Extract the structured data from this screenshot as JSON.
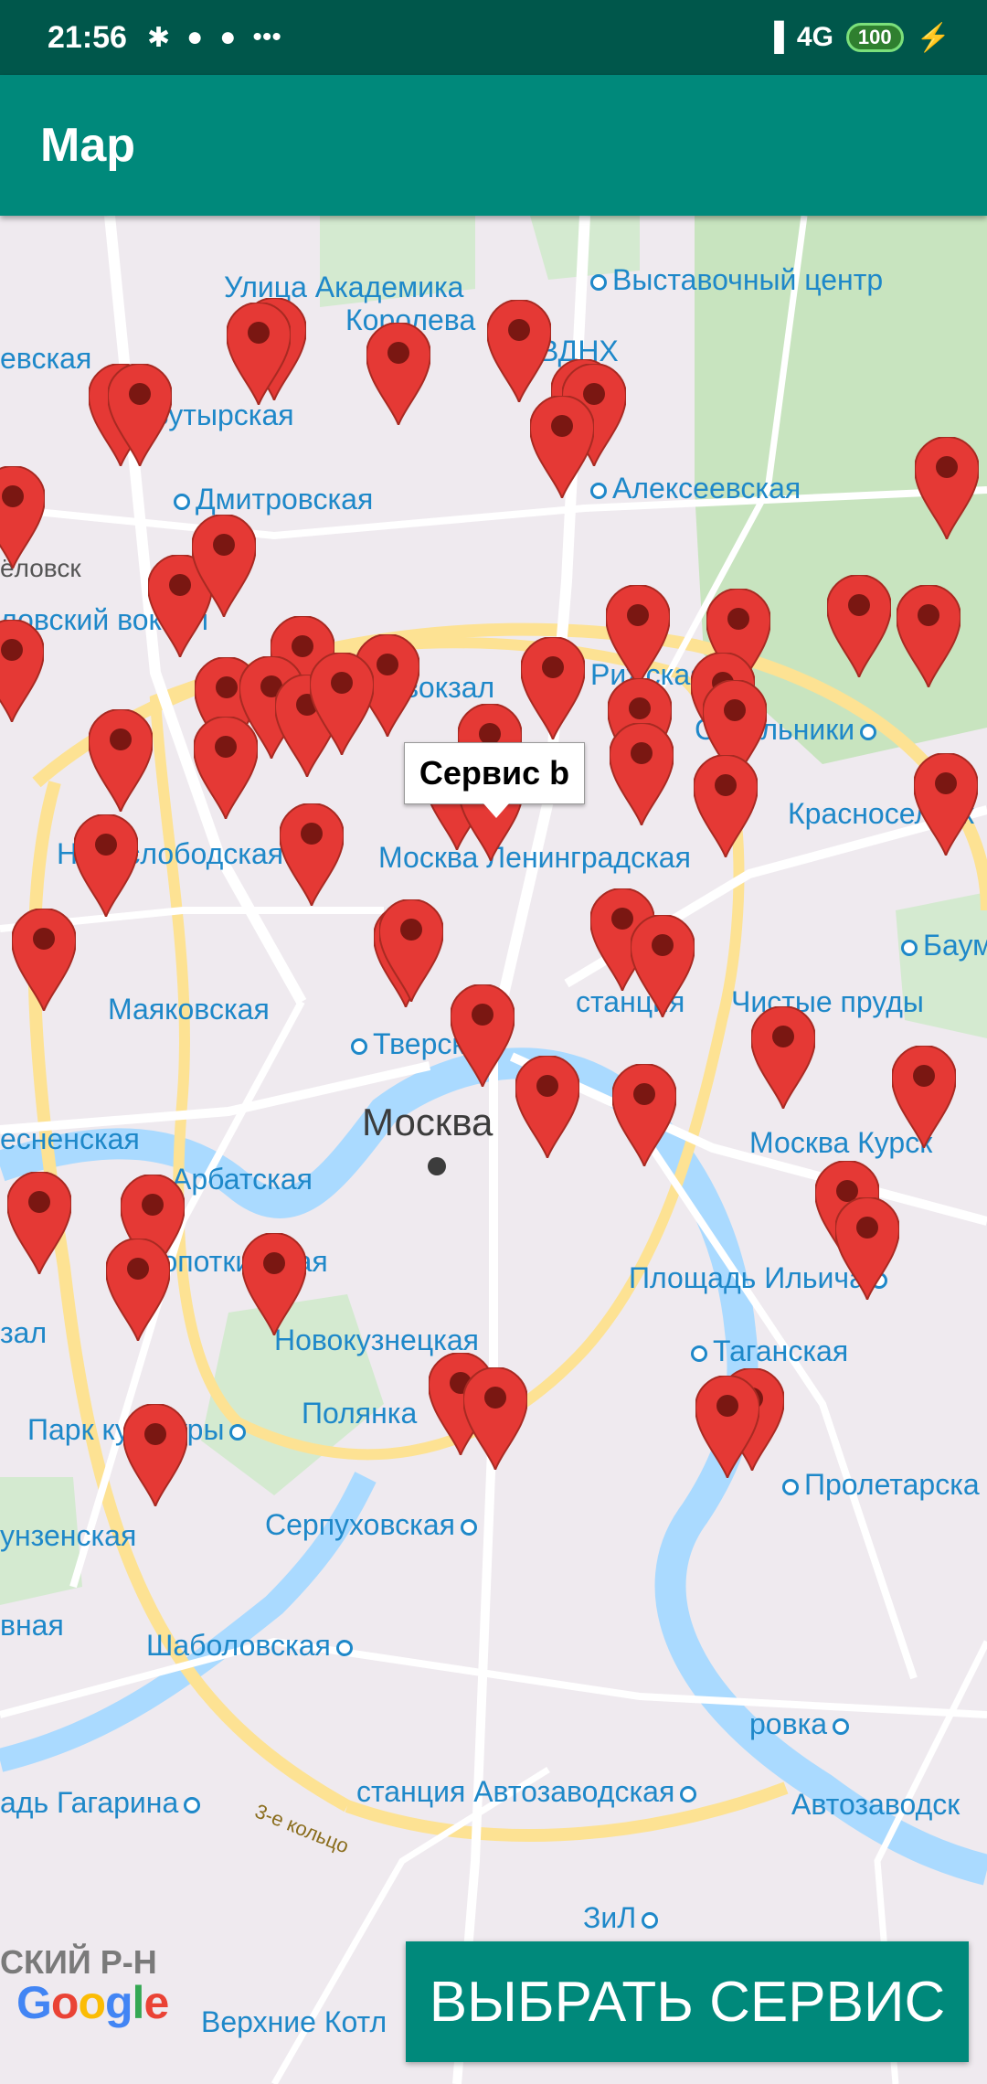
{
  "status_bar": {
    "time": "21:56",
    "icons": [
      "bluetooth-icon",
      "chat-icon",
      "chat-icon",
      "more-icon"
    ],
    "network": "4G",
    "battery": "100",
    "charging_icon": "charging-icon"
  },
  "app_bar": {
    "title": "Map"
  },
  "map": {
    "tooltip": "Сервис b",
    "select_button": "ВЫБРАТЬ СЕРВИС",
    "attribution": "Google",
    "marker_color": "#e53935",
    "labels": {
      "akademika_1": "Улица Академика",
      "akademika_2": "Королева",
      "vystavochny": "Выставочный центр",
      "vdnh": "ВДНХ",
      "savelovskaya": "евская",
      "butyrskaya": "Бутырская",
      "alekseevskaya": "Алексеевская",
      "dmitrovskaya": "Дмитровская",
      "belorusskaya_1": "ёловск",
      "belorusskaya_2": "ловский вокзал",
      "rizhsky": "Рижский вокзал",
      "rizhskaya": "Рижская",
      "sokolniki": "Сокольники",
      "krasnoselskaya": "Красносельск",
      "novoslobodskaya": "Новослободская",
      "leningradskaya": "Москва Ленинградская",
      "baumanskaya": "Баум",
      "mayakovskaya": "Маяковская",
      "tverskaya": "Тверская",
      "stanciya": "станция",
      "chistye": "Чистые пруды",
      "moskva": "Москва",
      "presnenskaya": "есненская",
      "arbatskaya": "Арбатская",
      "kursky": "Москва Курск",
      "kropotkinskaya": "Кропоткинская",
      "ilicha": "Площадь Ильича",
      "vokzal": "зал",
      "novokuznetskaya": "Новокузнецкая",
      "taganskaya": "Таганская",
      "park_kultury": "Парк культуры",
      "polyanka": "Полянка",
      "proletarskaya": "Пролетарска",
      "frunzenskaya": "унзенская",
      "serpukhovskaya": "Серпуховская",
      "shabolovskaya": "Шаболовская",
      "vnaya": "вная",
      "krutitskoe": "ровка",
      "gagarina": "адь Гагарина",
      "avtozavodskaya_st": "станция Автозаводская",
      "avtozavodskaya": "Автозаводск",
      "ring3": "3-е кольцо",
      "zil": "ЗиЛ",
      "district": "СКИЙ Р-Н",
      "kotly": "Верхние Котл"
    }
  }
}
